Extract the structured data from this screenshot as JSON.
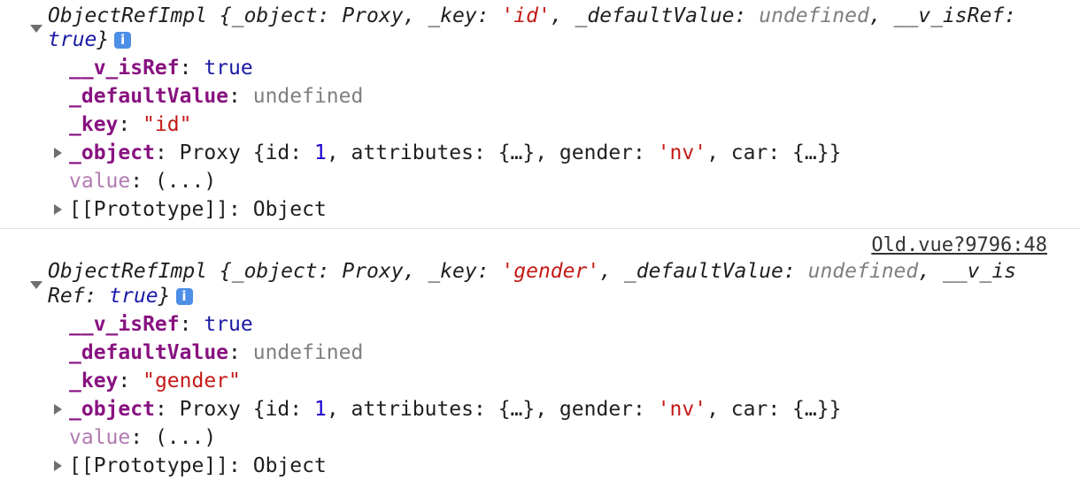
{
  "entries": [
    {
      "source_link": "",
      "summary": {
        "class_name": "ObjectRefImpl",
        "line1_rest": "_object",
        "object_value": "Proxy",
        "key_label": "_key",
        "key_value": "'id'",
        "default_label": "_defaultValue",
        "default_value": "undefined",
        "isref_label_1": "__v_isRef",
        "isref_label_2": "",
        "isref_value": "true",
        "info_icon": "i"
      },
      "props": {
        "isref": {
          "label": "__v_isRef",
          "value": "true"
        },
        "default": {
          "label": "_defaultValue",
          "value": "undefined"
        },
        "key": {
          "label": "_key",
          "value": "\"id\""
        },
        "object": {
          "label": "_object",
          "value_prefix": "Proxy {id: ",
          "id": "1",
          "mid": ", attributes: {…}, gender: ",
          "gender": "'nv'",
          "suffix": ", car: {…}}"
        },
        "value": {
          "label": "value",
          "value": "(...)"
        },
        "proto": {
          "label": "[[Prototype]]",
          "value": "Object"
        }
      }
    },
    {
      "source_link": "Old.vue?9796:48",
      "summary": {
        "class_name": "ObjectRefImpl",
        "line1_rest": "_object",
        "object_value": "Proxy",
        "key_label": "_key",
        "key_value": "'gender'",
        "default_label": "_defaultValue",
        "default_value": "undefined",
        "isref_label_1": "__v_is",
        "isref_label_2": "Ref",
        "isref_value": "true",
        "info_icon": "i"
      },
      "props": {
        "isref": {
          "label": "__v_isRef",
          "value": "true"
        },
        "default": {
          "label": "_defaultValue",
          "value": "undefined"
        },
        "key": {
          "label": "_key",
          "value": "\"gender\""
        },
        "object": {
          "label": "_object",
          "value_prefix": "Proxy {id: ",
          "id": "1",
          "mid": ", attributes: {…}, gender: ",
          "gender": "'nv'",
          "suffix": ", car: {…}}"
        },
        "value": {
          "label": "value",
          "value": "(...)"
        },
        "proto": {
          "label": "[[Prototype]]",
          "value": "Object"
        }
      }
    }
  ]
}
